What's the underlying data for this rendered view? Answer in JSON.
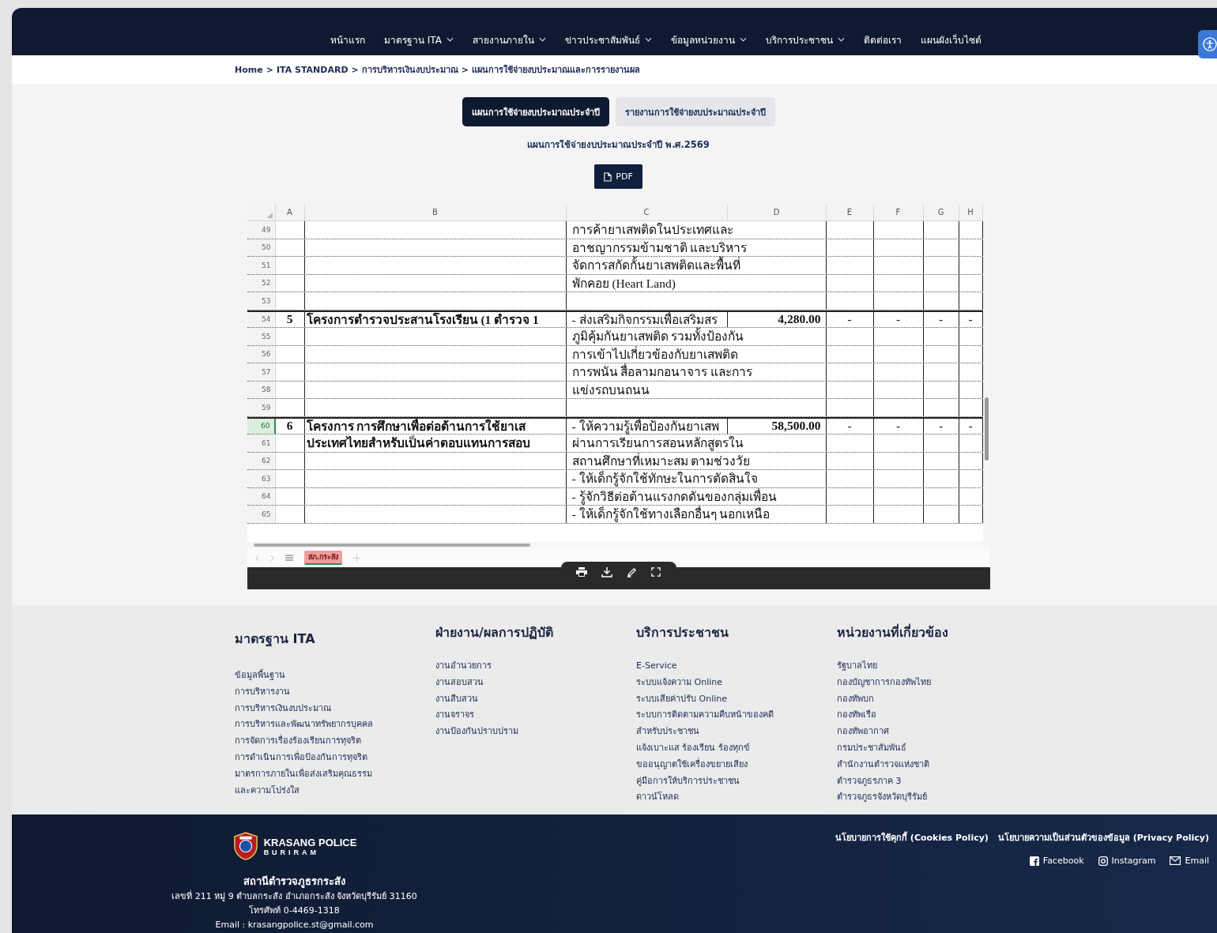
{
  "nav": {
    "items": [
      {
        "label": "หน้าแรก",
        "has_menu": false
      },
      {
        "label": "มาตรฐาน ITA",
        "has_menu": true
      },
      {
        "label": "สายงานภายใน",
        "has_menu": true
      },
      {
        "label": "ข่าวประชาสัมพันธ์",
        "has_menu": true
      },
      {
        "label": "ข้อมูลหน่วยงาน",
        "has_menu": true
      },
      {
        "label": "บริการประชาชน",
        "has_menu": true
      },
      {
        "label": "ติดต่อเรา",
        "has_menu": false
      },
      {
        "label": "แผนผังเว็บไซต์",
        "has_menu": false
      }
    ]
  },
  "breadcrumb": [
    "Home",
    "ITA STANDARD",
    "การบริหารเงินงบประมาณ",
    "แผนการใช้จ่ายงบประมาณและการรายงานผล"
  ],
  "breadcrumb_separator": ">",
  "tabs": [
    {
      "label": "แผนการใช้จ่ายงบประมาณประจำปี",
      "selected": true
    },
    {
      "label": "รายงานการใช้จ่ายงบประมาณประจำปี",
      "selected": false
    }
  ],
  "subtitle": "แผนการใช้จ่ายงบประมาณประจำปี พ.ศ.2569",
  "pdf_button": "PDF",
  "sheet": {
    "columns": [
      "A",
      "B",
      "C",
      "D",
      "E",
      "F",
      "G",
      "H"
    ],
    "rows": [
      {
        "num": "49",
        "group_start": false,
        "selected": false,
        "cells": [
          "",
          "",
          "การค้ายาเสพติดในประเทศและ",
          "",
          "",
          "",
          "",
          ""
        ]
      },
      {
        "num": "50",
        "group_start": false,
        "selected": false,
        "cells": [
          "",
          "",
          "อาชญากรรมข้ามชาติ และบริหาร",
          "",
          "",
          "",
          "",
          ""
        ]
      },
      {
        "num": "51",
        "group_start": false,
        "selected": false,
        "cells": [
          "",
          "",
          "จัดการสกัดกั้นยาเสพติดและพื้นที่",
          "",
          "",
          "",
          "",
          ""
        ]
      },
      {
        "num": "52",
        "group_start": false,
        "selected": false,
        "cells": [
          "",
          "",
          "พักคอย (Heart Land)",
          "",
          "",
          "",
          "",
          ""
        ]
      },
      {
        "num": "53",
        "group_start": false,
        "selected": false,
        "cells": [
          "",
          "",
          "",
          "",
          "",
          "",
          "",
          ""
        ]
      },
      {
        "num": "54",
        "group_start": true,
        "selected": false,
        "cells": [
          "5",
          "โครงการตำรวจประสานโรงเรียน (1 ตำรวจ 1",
          "- ส่งเสริมกิจกรรมเพื่อเสริมสร",
          "4,280.00",
          "-",
          "-",
          "-",
          "-"
        ]
      },
      {
        "num": "55",
        "group_start": false,
        "selected": false,
        "cells": [
          "",
          "",
          "ภูมิคุ้มกันยาเสพติด รวมทั้งป้องกัน",
          "",
          "",
          "",
          "",
          ""
        ]
      },
      {
        "num": "56",
        "group_start": false,
        "selected": false,
        "cells": [
          "",
          "",
          "การเข้าไปเกี่ยวข้องกับยาเสพติด",
          "",
          "",
          "",
          "",
          ""
        ]
      },
      {
        "num": "57",
        "group_start": false,
        "selected": false,
        "cells": [
          "",
          "",
          "การพนัน สื่อลามกอนาจาร และการ",
          "",
          "",
          "",
          "",
          ""
        ]
      },
      {
        "num": "58",
        "group_start": false,
        "selected": false,
        "cells": [
          "",
          "",
          "แข่งรถบนถนน",
          "",
          "",
          "",
          "",
          ""
        ]
      },
      {
        "num": "59",
        "group_start": false,
        "selected": false,
        "cells": [
          "",
          "",
          "",
          "",
          "",
          "",
          "",
          ""
        ]
      },
      {
        "num": "60",
        "group_start": true,
        "selected": true,
        "cells": [
          "6",
          "โครงการ การศึกษาเพื่อต่อต้านการใช้ยาเส",
          "- ให้ความรู้เพื่อป้องกันยาเสพ",
          "58,500.00",
          "-",
          "-",
          "-",
          "-"
        ]
      },
      {
        "num": "61",
        "group_start": false,
        "selected": false,
        "cells": [
          "",
          "ประเทศไทยสำหรับเป็นค่าตอบแทนการสอบ",
          "ผ่านการเรียนการสอนหลักสูตรใน",
          "",
          "",
          "",
          "",
          ""
        ]
      },
      {
        "num": "62",
        "group_start": false,
        "selected": false,
        "cells": [
          "",
          "",
          "สถานศึกษาที่เหมาะสม ตามช่วงวัย",
          "",
          "",
          "",
          "",
          ""
        ]
      },
      {
        "num": "63",
        "group_start": false,
        "selected": false,
        "cells": [
          "",
          "",
          "- ให้เด็กรู้จักใช้ทักษะในการตัดสินใจ",
          "",
          "",
          "",
          "",
          ""
        ]
      },
      {
        "num": "64",
        "group_start": false,
        "selected": false,
        "cells": [
          "",
          "",
          "- รู้จักวิธีต่อต้านแรงกดดันของกลุ่มเพื่อน",
          "",
          "",
          "",
          "",
          ""
        ]
      },
      {
        "num": "65",
        "group_start": false,
        "selected": false,
        "cells": [
          "",
          "",
          "- ให้เด็กรู้จักใช้ทางเลือกอื่นๆ นอกเหนือ",
          "",
          "",
          "",
          "",
          ""
        ]
      }
    ],
    "sheet_tabs": [
      {
        "label": "สภ.กระสัง",
        "selected": true
      }
    ]
  },
  "footer": {
    "columns": [
      {
        "title": "มาตรฐาน ITA",
        "links": [
          "ข้อมูลพื้นฐาน",
          "การบริหารงาน",
          "การบริหารเงินงบประมาณ",
          "การบริหารและพัฒนาทรัพยากรบุคคล",
          "การจัดการเรื่องร้องเรียนการทุจริต",
          "การดำเนินการเพื่อป้องกันการทุจริต",
          "มาตรการภายในเพื่อส่งเสริมคุณธรรม",
          "และความโปร่งใส"
        ]
      },
      {
        "title": "ฝ่ายงาน/ผลการปฏิบัติ",
        "links": [
          "งานอำนวยการ",
          "งานสอบสวน",
          "งานสืบสวน",
          "งานจราจร",
          "งานป้องกันปราบปราม"
        ]
      },
      {
        "title": "บริการประชาชน",
        "links": [
          "E-Service",
          "ระบบแจ้งความ Online",
          "ระบบเสียค่าปรับ Online",
          "ระบบการติดตามความคืบหน้าของคดี",
          "สำหรับประชาชน",
          "แจ้งเบาะแส ร้องเรียน ร้องทุกข์",
          "ขออนุญาตใช้เครื่องขยายเสียง",
          "คู่มือการให้บริการประชาชน",
          "ดาวน์โหลด"
        ]
      },
      {
        "title": "หน่วยงานที่เกี่ยวข้อง",
        "links": [
          "รัฐบาลไทย",
          "กองบัญชาการกองทัพไทย",
          "กองทัพบก",
          "กองทัพเรือ",
          "กองทัพอากาศ",
          "กรมประชาสัมพันธ์",
          "สำนักงานตำรวจแห่งชาติ",
          "ตำรวจภูธรภาค 3",
          "ตำรวจภูธรจังหวัดบุรีรัมย์"
        ]
      }
    ]
  },
  "bottom": {
    "logo_name": "KRASANG POLICE",
    "logo_sub": "BURIRAM",
    "station": "สถานีตำรวจภูธรกระสัง",
    "address": "เลขที่ 211 หมู่ 9 ตำบลกระสัง อำเภอกระสัง จังหวัดบุรีรัมย์ 31160",
    "phone": "โทรศัพท์ 0-4469-1318",
    "email": "Email : krasangpolice.st@gmail.com",
    "policies": [
      "นโยบายการใช้คุกกี้ (Cookies Policy)",
      "นโยบายความเป็นส่วนตัวของข้อมูล (Privacy Policy)"
    ],
    "social": [
      {
        "kind": "facebook",
        "label": "Facebook"
      },
      {
        "kind": "instagram",
        "label": "Instagram"
      },
      {
        "kind": "email",
        "label": "Email"
      }
    ]
  }
}
